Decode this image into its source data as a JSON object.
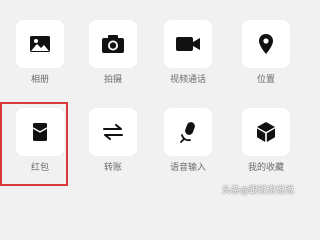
{
  "panel": {
    "row1": [
      {
        "label": "相册",
        "icon": "photo-album-icon"
      },
      {
        "label": "拍摄",
        "icon": "camera-icon"
      },
      {
        "label": "视频通话",
        "icon": "video-call-icon"
      },
      {
        "label": "位置",
        "icon": "location-pin-icon"
      }
    ],
    "row2": [
      {
        "label": "红包",
        "icon": "red-packet-icon"
      },
      {
        "label": "转账",
        "icon": "transfer-icon"
      },
      {
        "label": "语音输入",
        "icon": "voice-input-icon"
      },
      {
        "label": "我的收藏",
        "icon": "favorites-icon"
      }
    ]
  },
  "highlight": {
    "color": "#d83a3a",
    "target": "红包"
  },
  "watermark": {
    "text": "头条@跟说说说说"
  },
  "colors": {
    "background": "#f1f1f1",
    "tile": "#ffffff",
    "icon": "#111111",
    "label": "#6b6b6b"
  }
}
